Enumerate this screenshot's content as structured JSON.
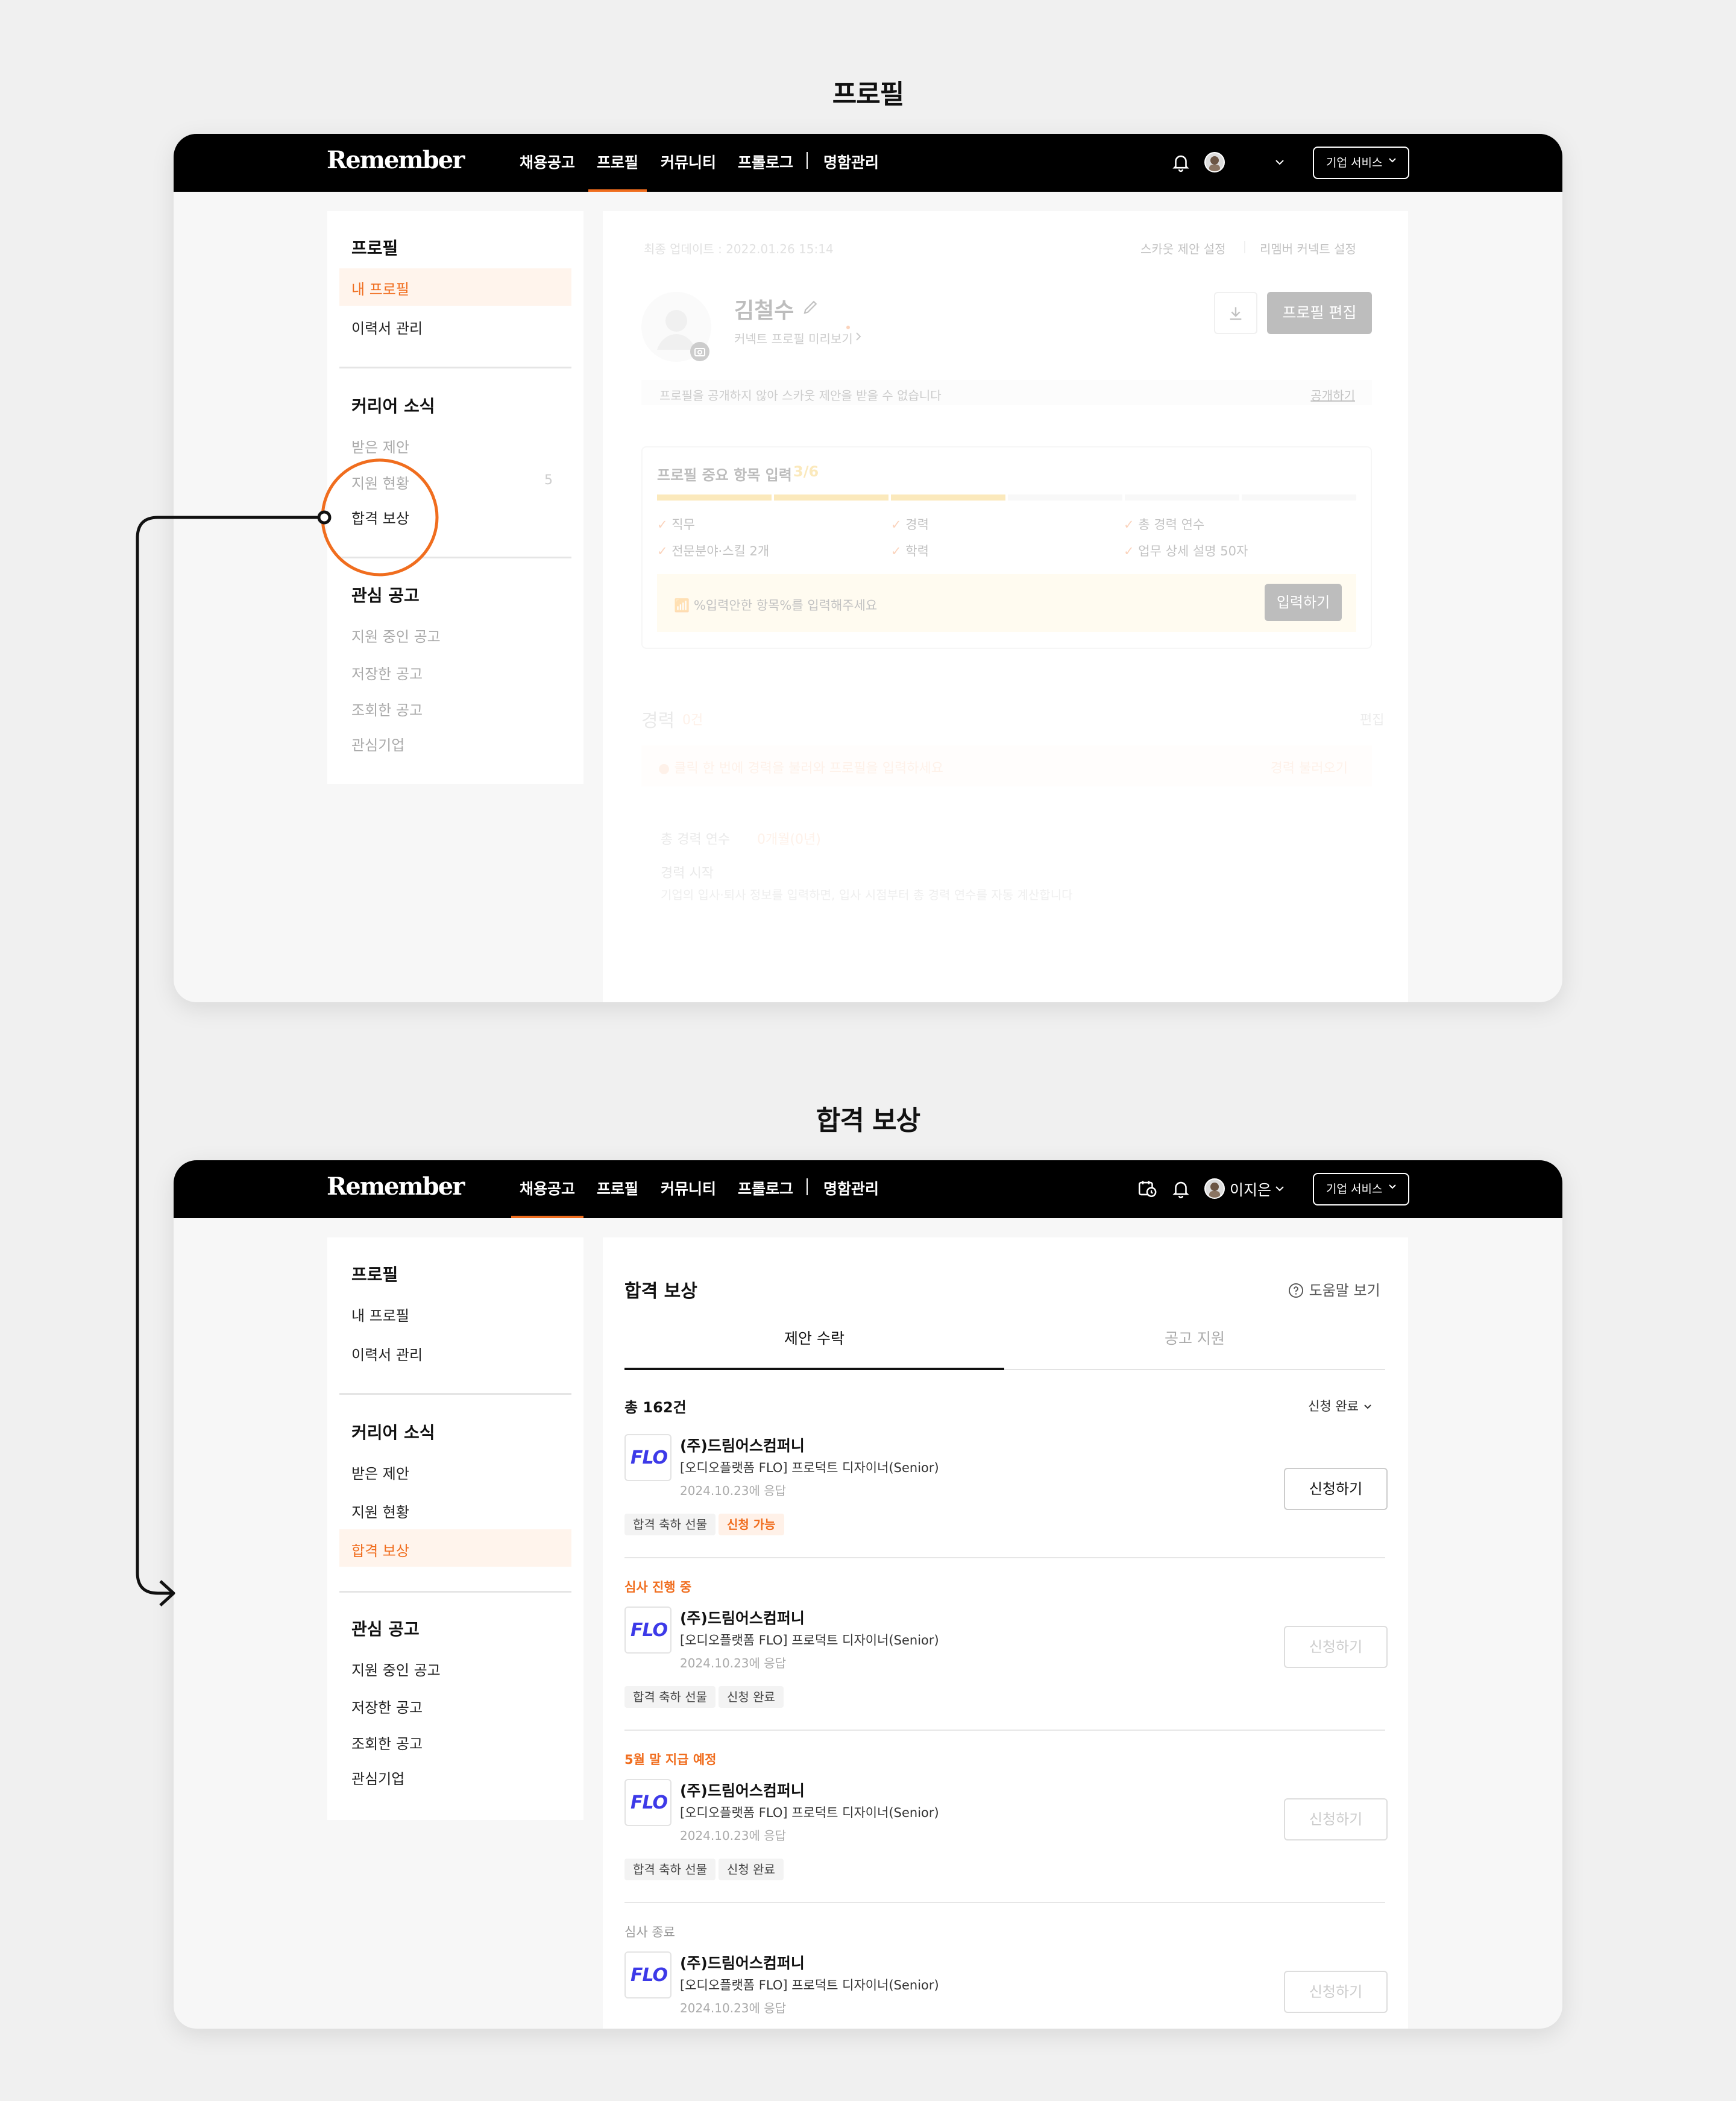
{
  "sections": {
    "top_title": "프로필",
    "bottom_title": "합격 보상"
  },
  "topbar": {
    "logo": "Remember",
    "nav": [
      "채용공고",
      "프로필",
      "커뮤니티",
      "프롤로그",
      "명함관리"
    ],
    "user_name": "이지은",
    "corp_service": "기업 서비스"
  },
  "sidebar": {
    "profile_heading": "프로필",
    "my_profile": "내 프로필",
    "resume": "이력서 관리",
    "career_heading": "커리어 소식",
    "received_offers": "받은 제안",
    "application_status": "지원 현황",
    "application_count": "5",
    "reward": "합격 보상",
    "interest_heading": "관심 공고",
    "applying_jobs": "지원 중인 공고",
    "saved_jobs": "저장한 공고",
    "viewed_jobs": "조회한 공고",
    "interest_companies": "관심기업"
  },
  "profile_page": {
    "last_update": "최종 업데이트 : 2022.01.26 15:14",
    "scout_setting": "스카웃 제안 설정",
    "connect_setting": "리멤버 커넥트 설정",
    "name": "김철수",
    "preview_link": "커넥트 프로필 미리보기",
    "edit_button": "프로필 편집",
    "notice": "프로필을 공개하지 않아 스카웃 제안을 받을 수 없습니다",
    "publish_link": "공개하기",
    "important_title": "프로필 중요 항목 입력",
    "important_progress": "3/6",
    "progress_fraction": 0.5,
    "checklist": [
      "직무",
      "경력",
      "총 경력 연수",
      "전문분야·스킬 2개",
      "학력",
      "업무 상세 설명 50자"
    ],
    "input_prompt": "%입력안한 항목%를 입력해주세요",
    "input_button": "입력하기",
    "career_title": "경력",
    "career_count": "0건",
    "career_edit": "편집",
    "career_banner": "클릭 한 번에 경력을 불러와 프로필을 입력하세요",
    "career_banner_link": "경력 불러오기",
    "total_years_label": "총 경력 연수",
    "total_years_value": "0개월(0년)",
    "career_start_label": "경력 시작",
    "career_start_desc": "기업의 입사·퇴사 정보를 입력하면, 입사 시점부터 총 경력 연수를 자동 계산합니다"
  },
  "reward_page": {
    "title": "합격 보상",
    "help": "도움말 보기",
    "tabs": [
      "제안 수락",
      "공고 지원"
    ],
    "total": "총 162건",
    "filter": "신청 완료",
    "cards": [
      {
        "status": "",
        "company": "(주)드림어스컴퍼니",
        "position": "[오디오플랫폼 FLO] 프로덕트 디자이너(Senior)",
        "date": "2024.10.23에 응답",
        "tag1": "합격 축하 선물",
        "tag2": "신청 가능",
        "button": "신청하기"
      },
      {
        "status": "심사 진행 중",
        "company": "(주)드림어스컴퍼니",
        "position": "[오디오플랫폼 FLO] 프로덕트 디자이너(Senior)",
        "date": "2024.10.23에 응답",
        "tag1": "합격 축하 선물",
        "tag2": "신청 완료",
        "button": "신청하기"
      },
      {
        "status": "5월 말 지급 예정",
        "company": "(주)드림어스컴퍼니",
        "position": "[오디오플랫폼 FLO] 프로덕트 디자이너(Senior)",
        "date": "2024.10.23에 응답",
        "tag1": "합격 축하 선물",
        "tag2": "신청 완료",
        "button": "신청하기"
      },
      {
        "status": "심사 종료",
        "company": "(주)드림어스컴퍼니",
        "position": "[오디오플랫폼 FLO] 프로덕트 디자이너(Senior)",
        "date": "2024.10.23에 응답",
        "button": "신청하기"
      }
    ],
    "company_logo_text": "FLO"
  },
  "colors": {
    "accent": "#f06d1e",
    "flo_blue": "#3d3ae8",
    "topbar": "#000000"
  }
}
